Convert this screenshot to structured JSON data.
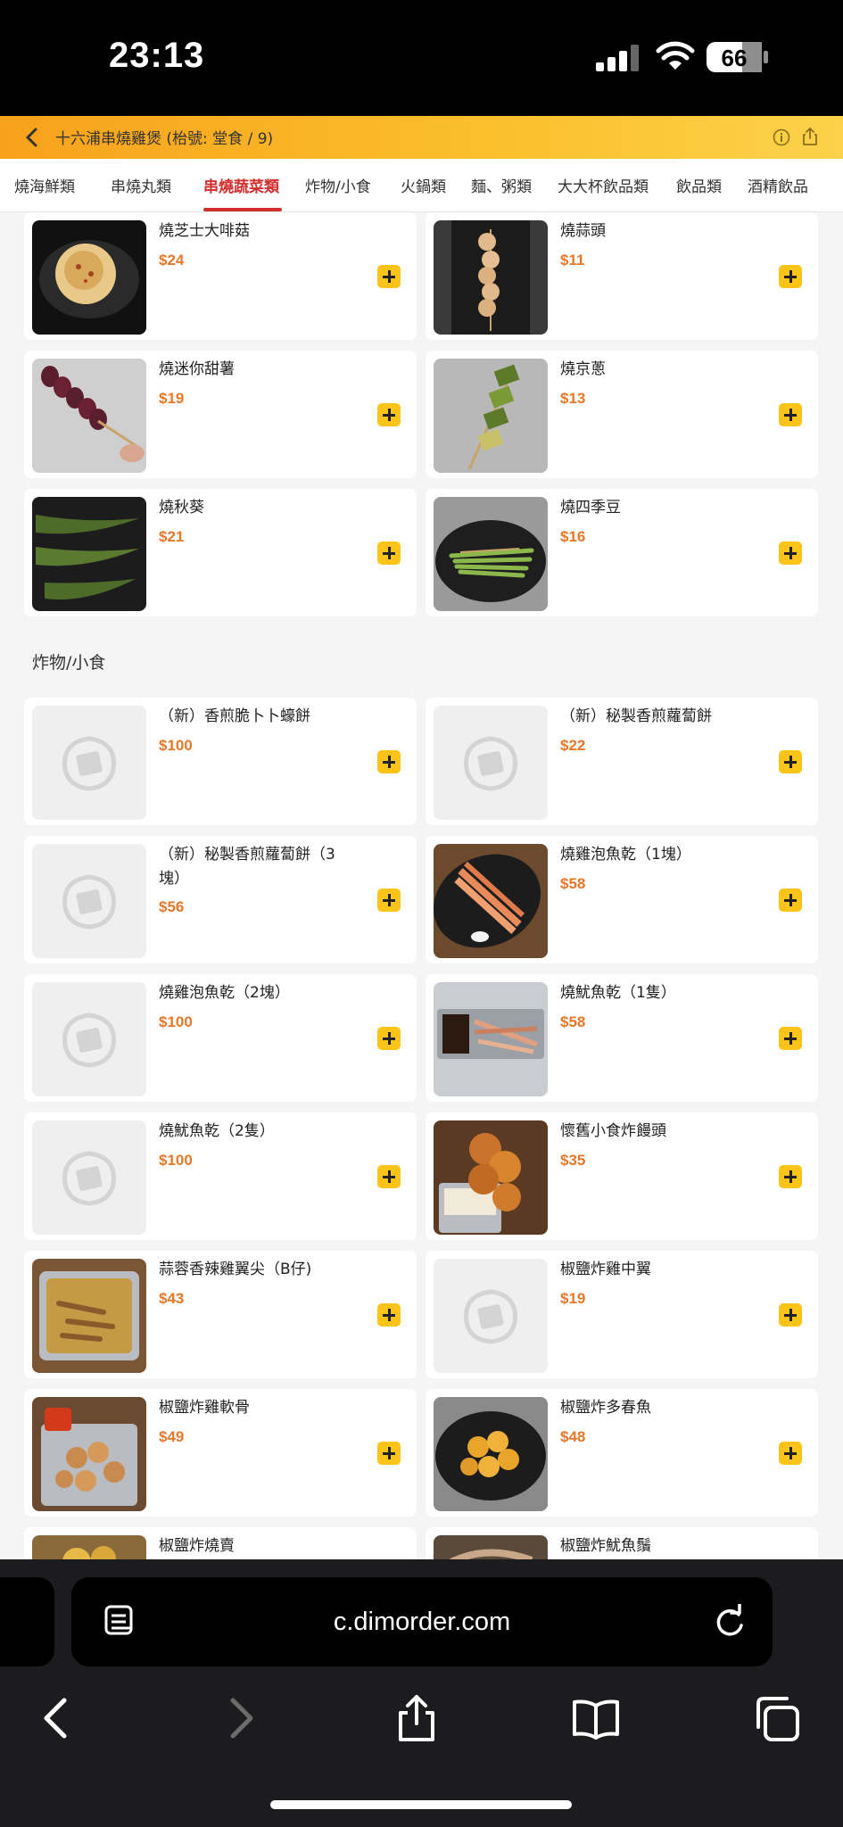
{
  "status_bar": {
    "time": "23:13",
    "battery": "66"
  },
  "header": {
    "title": "十六浦串燒雞煲 (枱號: 堂食 / 9)"
  },
  "tabs": [
    {
      "label": "燒海鮮類",
      "active": false
    },
    {
      "label": "串燒丸類",
      "active": false
    },
    {
      "label": "串燒蔬菜類",
      "active": true
    },
    {
      "label": "炸物/小食",
      "active": false
    },
    {
      "label": "火鍋類",
      "active": false
    },
    {
      "label": "麵、粥類",
      "active": false
    },
    {
      "label": "大大杯飲品類",
      "active": false
    },
    {
      "label": "飲品類",
      "active": false
    },
    {
      "label": "酒精飲品",
      "active": false
    }
  ],
  "veg_items": [
    {
      "name": "燒芝士大啡菇",
      "price": "$24"
    },
    {
      "name": "燒蒜頭",
      "price": "$11"
    },
    {
      "name": "燒迷你甜薯",
      "price": "$19"
    },
    {
      "name": "燒京蔥",
      "price": "$13"
    },
    {
      "name": "燒秋葵",
      "price": "$21"
    },
    {
      "name": "燒四季豆",
      "price": "$16"
    }
  ],
  "section_fried": {
    "title": "炸物/小食"
  },
  "fried_items": [
    {
      "name": "（新）香煎脆卜卜蠔餅",
      "price": "$100"
    },
    {
      "name": "（新）秘製香煎蘿蔔餅",
      "price": "$22"
    },
    {
      "name": "（新）秘製香煎蘿蔔餅（3塊）",
      "price": "$56"
    },
    {
      "name": "燒雞泡魚乾（1塊）",
      "price": "$58"
    },
    {
      "name": "燒雞泡魚乾（2塊）",
      "price": "$100"
    },
    {
      "name": "燒魷魚乾（1隻）",
      "price": "$58"
    },
    {
      "name": "燒魷魚乾（2隻）",
      "price": "$100"
    },
    {
      "name": "懷舊小食炸饅頭",
      "price": "$35"
    },
    {
      "name": "蒜蓉香辣雞翼尖（B仔)",
      "price": "$43"
    },
    {
      "name": "椒鹽炸雞中翼",
      "price": "$19"
    },
    {
      "name": "椒鹽炸雞軟骨",
      "price": "$49"
    },
    {
      "name": "椒鹽炸多春魚",
      "price": "$48"
    },
    {
      "name": "椒鹽炸燒賣",
      "price": ""
    },
    {
      "name": "椒鹽炸魷魚鬚",
      "price": ""
    }
  ],
  "browser": {
    "url": "c.dimorder.com"
  },
  "colors": {
    "accent": "#d32f2f",
    "header": "#fbc02d",
    "price": "#e6782a",
    "add_button": "#fcc419"
  }
}
